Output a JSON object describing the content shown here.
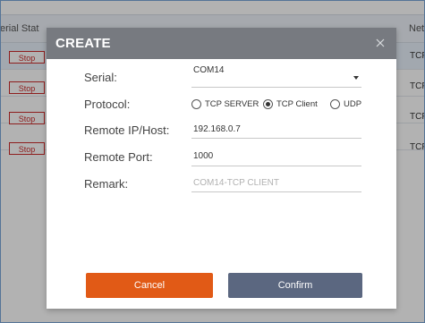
{
  "background_table": {
    "headers": {
      "serial_status": "erial Stat",
      "net": "Net"
    },
    "rows": [
      {
        "action": "Stop",
        "net": "TCP"
      },
      {
        "action": "Stop",
        "net": "TCP"
      },
      {
        "action": "Stop",
        "net": "TCP"
      },
      {
        "action": "Stop",
        "net": "TCP"
      }
    ]
  },
  "dialog": {
    "title": "CREATE",
    "close_icon": "close-icon",
    "fields": {
      "serial": {
        "label": "Serial:",
        "value": "COM14"
      },
      "protocol": {
        "label": "Protocol:",
        "options": [
          "TCP SERVER",
          "TCP Client",
          "UDP"
        ],
        "selected": "TCP Client"
      },
      "remote_ip": {
        "label": "Remote IP/Host:",
        "value": "192.168.0.7"
      },
      "remote_port": {
        "label": "Remote Port:",
        "value": "1000"
      },
      "remark": {
        "label": "Remark:",
        "placeholder": "COM14-TCP CLIENT"
      }
    },
    "buttons": {
      "cancel": "Cancel",
      "confirm": "Confirm"
    }
  },
  "colors": {
    "cancel": "#e15a16",
    "confirm": "#5b6780",
    "header": "#777a80",
    "stop": "#cc2b2b"
  }
}
